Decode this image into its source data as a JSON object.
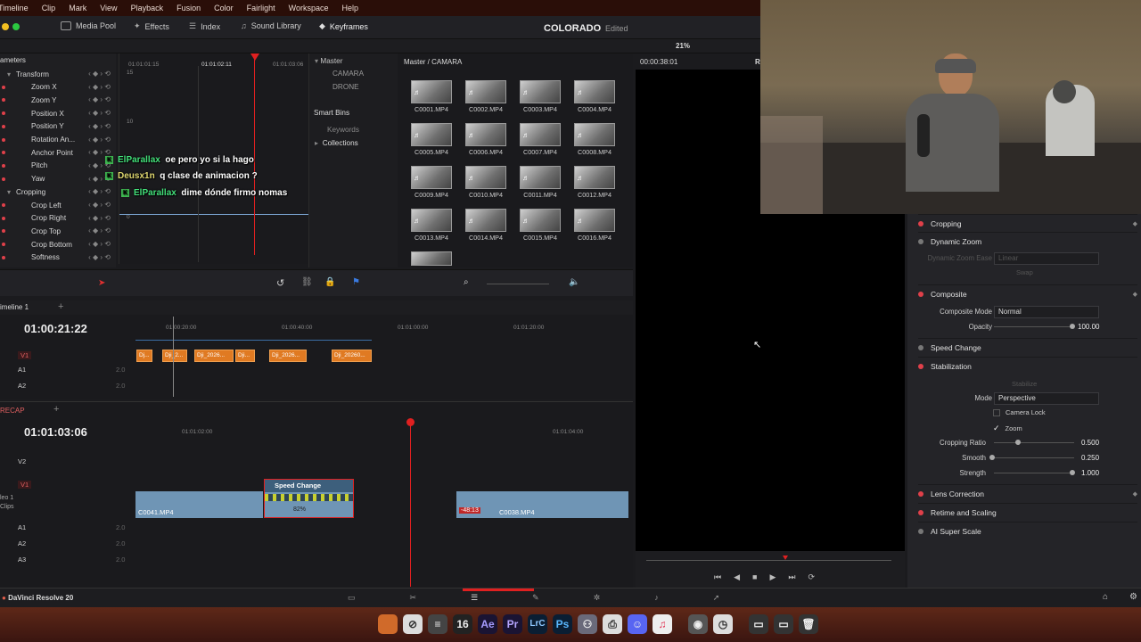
{
  "menu": [
    "Timeline",
    "Clip",
    "Mark",
    "View",
    "Playback",
    "Fusion",
    "Color",
    "Fairlight",
    "Workspace",
    "Help"
  ],
  "toolbar": {
    "media_pool": "Media Pool",
    "effects": "Effects",
    "index": "Index",
    "sound_library": "Sound Library",
    "keyframes": "Keyframes",
    "project_title": "COLORADO",
    "project_status": "Edited",
    "zoom": "21%"
  },
  "viewer": {
    "timecode": "00:00:38:01",
    "r_label": "R"
  },
  "keyframes": {
    "header": "ameters",
    "ruler": [
      "01:01:01:15",
      "01:01:02:11",
      "01:01:03:06"
    ],
    "graph_labels": [
      "15",
      "10",
      "0"
    ],
    "rows": [
      {
        "label": "Transform",
        "type": "group"
      },
      {
        "label": "Zoom X",
        "type": "item"
      },
      {
        "label": "Zoom Y",
        "type": "item"
      },
      {
        "label": "Position X",
        "type": "item"
      },
      {
        "label": "Position Y",
        "type": "item"
      },
      {
        "label": "Rotation An...",
        "type": "item"
      },
      {
        "label": "Anchor Point",
        "type": "item"
      },
      {
        "label": "Pitch",
        "type": "item"
      },
      {
        "label": "Yaw",
        "type": "item"
      },
      {
        "label": "Cropping",
        "type": "group"
      },
      {
        "label": "Crop Left",
        "type": "item"
      },
      {
        "label": "Crop Right",
        "type": "item"
      },
      {
        "label": "Crop Top",
        "type": "item"
      },
      {
        "label": "Crop Bottom",
        "type": "item"
      },
      {
        "label": "Softness",
        "type": "item"
      }
    ]
  },
  "chat": [
    {
      "user": "ElParallax",
      "msg": "oe pero yo si la hago",
      "color": "#43e07a"
    },
    {
      "user": "Deusx1n",
      "msg": "q clase de animacion ?",
      "color": "#e0d870"
    },
    {
      "user": "ElParallax",
      "msg": "dime dónde firmo nomas",
      "color": "#43e07a"
    }
  ],
  "bins": {
    "master": "Master",
    "items": [
      "CAMARA",
      "DRONE"
    ],
    "smart_bins": "Smart Bins",
    "keywords": "Keywords",
    "collections": "Collections"
  },
  "mediapool": {
    "path": "Master / CAMARA",
    "clips": [
      "C0001.MP4",
      "C0002.MP4",
      "C0003.MP4",
      "C0004.MP4",
      "C0005.MP4",
      "C0006.MP4",
      "C0007.MP4",
      "C0008.MP4",
      "C0009.MP4",
      "C0010.MP4",
      "C0011.MP4",
      "C0012.MP4",
      "C0013.MP4",
      "C0014.MP4",
      "C0015.MP4",
      "C0016.MP4"
    ]
  },
  "timeline1": {
    "name": "imeline 1",
    "timecode": "01:00:21:22",
    "ruler": [
      "01:00:20:00",
      "01:00:40:00",
      "01:01:00:00",
      "01:01:20:00"
    ],
    "tracks": [
      "V1",
      "A1",
      "A2"
    ],
    "vol": "2.0",
    "clips": [
      "Dj...",
      "Dji_2...",
      "Dji_2026...",
      "Dji...",
      "Dji_2026...",
      "Dji_20260..."
    ]
  },
  "timeline2": {
    "name": "RECAP",
    "timecode": "01:01:03:06",
    "ruler": [
      "01:01:02:00",
      "01:01:04:00"
    ],
    "tracks": [
      "V2",
      "V1",
      "A1",
      "A2",
      "A3"
    ],
    "left_labels": [
      "leo 1",
      "Clips"
    ],
    "vol": "2.0",
    "clip_left": "C0041.MP4",
    "speed_title": "Speed Change",
    "speed_pct": "82%",
    "clip_right": "C0038.MP4",
    "clip_right_offset": "-48:13"
  },
  "inspector": {
    "cropping": "Cropping",
    "dynamic_zoom": "Dynamic Zoom",
    "dz_ease_label": "Dynamic Zoom Ease",
    "dz_ease_value": "Linear",
    "swap": "Swap",
    "composite": "Composite",
    "composite_mode_label": "Composite Mode",
    "composite_mode_value": "Normal",
    "opacity_label": "Opacity",
    "opacity_value": "100.00",
    "speed_change": "Speed Change",
    "stabilization": "Stabilization",
    "stabilize": "Stabilize",
    "mode_label": "Mode",
    "mode_value": "Perspective",
    "camera_lock": "Camera Lock",
    "zoom": "Zoom",
    "cropping_ratio_label": "Cropping Ratio",
    "cropping_ratio_value": "0.500",
    "smooth_label": "Smooth",
    "smooth_value": "0.250",
    "strength_label": "Strength",
    "strength_value": "1.000",
    "lens_correction": "Lens Correction",
    "retime_scaling": "Retime and Scaling",
    "ai_super_scale": "AI Super Scale"
  },
  "app_name": "DaVinci Resolve 20",
  "dock": [
    "16",
    "Ae",
    "Pr",
    "LrC",
    "Ps"
  ]
}
